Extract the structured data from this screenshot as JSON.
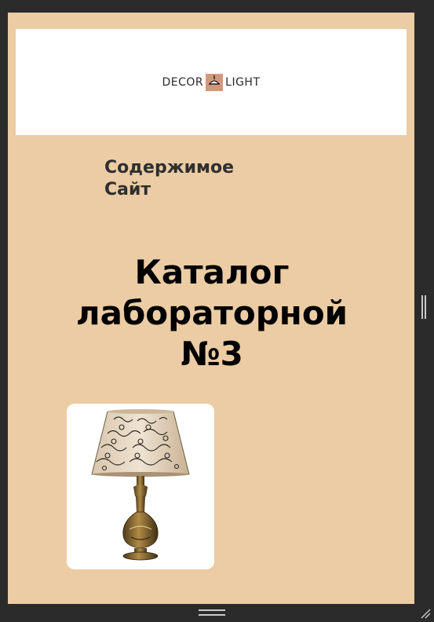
{
  "header": {
    "logo_left": "DECOR",
    "logo_right": "LIGHT",
    "logo_icon": "pendant-lamp-icon"
  },
  "nav": {
    "items": [
      "Содержимое",
      "Сайт"
    ]
  },
  "main": {
    "heading_lines": [
      "Каталог",
      "лабораторной",
      "№3"
    ]
  },
  "product": {
    "image_icon": "table-lamp-image"
  },
  "colors": {
    "page_background": "#ebcca4",
    "frame": "#2b2b2b",
    "banner": "#ffffff",
    "logo_accent": "#d3977c"
  }
}
